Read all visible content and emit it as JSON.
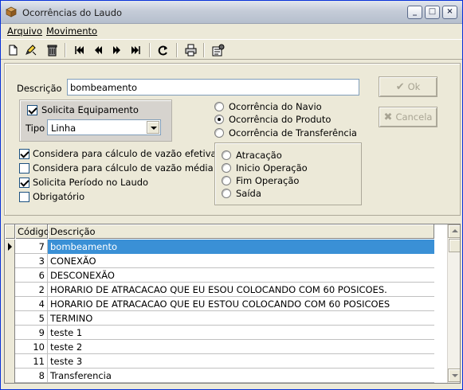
{
  "window": {
    "title": "Ocorrências do Laudo"
  },
  "titlebar_buttons": {
    "minimize": "_",
    "maximize": "□",
    "close": "×"
  },
  "menu": [
    {
      "label": "Arquivo"
    },
    {
      "label": "Movimento"
    }
  ],
  "toolbar": {
    "icons": [
      "new-icon",
      "edit-icon",
      "delete-icon",
      "first-icon",
      "prev-icon",
      "next-icon",
      "last-icon",
      "refresh-icon",
      "print-icon",
      "config-icon"
    ]
  },
  "form": {
    "descricao_label": "Descrição",
    "descricao_value": "bombeamento",
    "ok_label": "Ok",
    "cancel_label": "Cancela",
    "solicita_equipamento": {
      "label": "Solicita Equipamento",
      "checked": true
    },
    "tipo_label": "Tipo",
    "tipo_value": "Linha",
    "checkboxes": [
      {
        "label": "Considera para cálculo de vazão efetiva",
        "checked": true
      },
      {
        "label": "Considera para cálculo de vazão média",
        "checked": false
      },
      {
        "label": "Solicita Período no Laudo",
        "checked": true
      },
      {
        "label": "Obrigatório",
        "checked": false
      }
    ],
    "ocorrencia_radios": [
      {
        "label": "Ocorrência do Navio",
        "selected": false
      },
      {
        "label": "Ocorrência do Produto",
        "selected": true
      },
      {
        "label": "Ocorrência de Transferência",
        "selected": false
      }
    ],
    "operacao_radios": [
      {
        "label": "Atracação",
        "selected": false
      },
      {
        "label": "Inicio Operação",
        "selected": false
      },
      {
        "label": "Fim Operação",
        "selected": false
      },
      {
        "label": "Saída",
        "selected": false
      }
    ]
  },
  "grid": {
    "columns": [
      "Código",
      "Descrição"
    ],
    "rows": [
      {
        "code": "7",
        "desc": "bombeamento",
        "selected": true
      },
      {
        "code": "3",
        "desc": "CONEXÃO"
      },
      {
        "code": "6",
        "desc": "DESCONEXÃO"
      },
      {
        "code": "2",
        "desc": "HORARIO DE ATRACACAO QUE EU ESOU COLOCANDO COM 60 POSICOES."
      },
      {
        "code": "4",
        "desc": "HORARIO DE ATRACACAO QUE EU ESTOU COLOCANDO COM 60 POSICOES"
      },
      {
        "code": "5",
        "desc": "TERMINO"
      },
      {
        "code": "9",
        "desc": "teste 1"
      },
      {
        "code": "10",
        "desc": "teste 2"
      },
      {
        "code": "11",
        "desc": "teste 3"
      },
      {
        "code": "8",
        "desc": "Transferencia"
      }
    ]
  }
}
